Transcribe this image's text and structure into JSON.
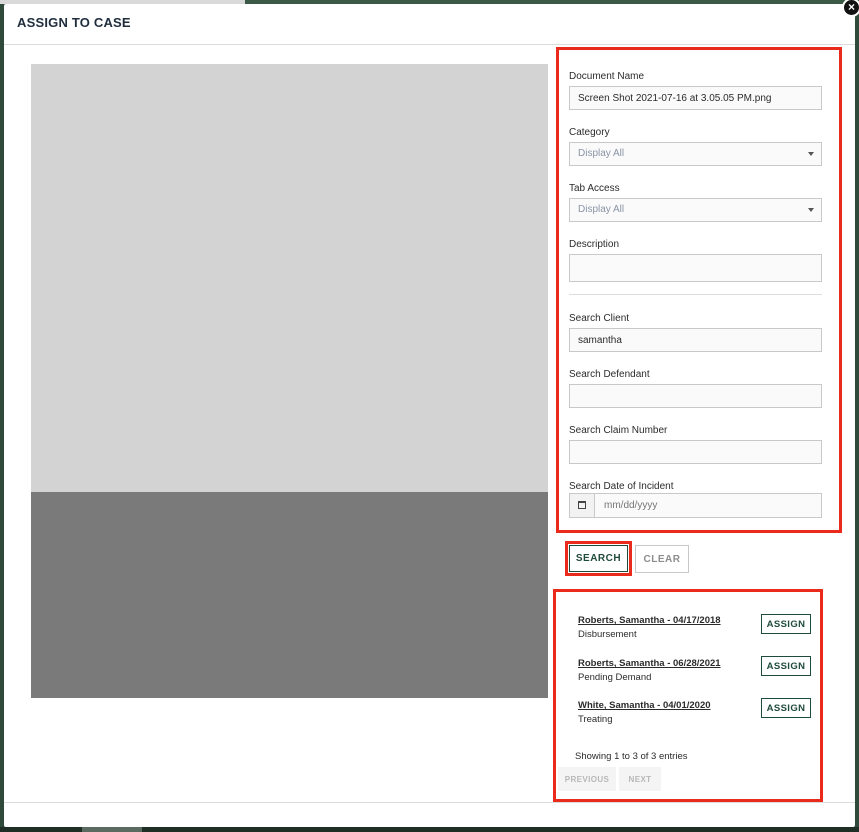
{
  "modal": {
    "title": "ASSIGN TO CASE",
    "close_glyph": "×"
  },
  "form": {
    "document_name": {
      "label": "Document Name",
      "value": "Screen Shot 2021-07-16 at 3.05.05 PM.png"
    },
    "category": {
      "label": "Category",
      "selected": "Display All"
    },
    "tab_access": {
      "label": "Tab Access",
      "selected": "Display All"
    },
    "description": {
      "label": "Description",
      "value": ""
    },
    "search_client": {
      "label": "Search Client",
      "value": "samantha"
    },
    "search_defendant": {
      "label": "Search Defendant",
      "value": ""
    },
    "search_claim_number": {
      "label": "Search Claim Number",
      "value": ""
    },
    "search_date_of_incident": {
      "label": "Search Date of Incident",
      "placeholder": "mm/dd/yyyy"
    }
  },
  "actions": {
    "search_label": "SEARCH",
    "clear_label": "CLEAR"
  },
  "results": {
    "items": [
      {
        "name": "Roberts, Samantha - 04/17/2018",
        "status": "Disbursement",
        "action": "ASSIGN"
      },
      {
        "name": "Roberts, Samantha - 06/28/2021",
        "status": "Pending Demand",
        "action": "ASSIGN"
      },
      {
        "name": "White, Samantha - 04/01/2020",
        "status": "Treating",
        "action": "ASSIGN"
      }
    ],
    "info": "Showing 1 to 3 of 3 entries",
    "previous_label": "PREVIOUS",
    "next_label": "NEXT"
  },
  "icons": {
    "close": "close-icon",
    "dropdown": "chevron-down-icon",
    "calendar": "calendar-icon"
  },
  "colors": {
    "accent": "#1f4b3b",
    "highlight": "#ea2a1a"
  }
}
